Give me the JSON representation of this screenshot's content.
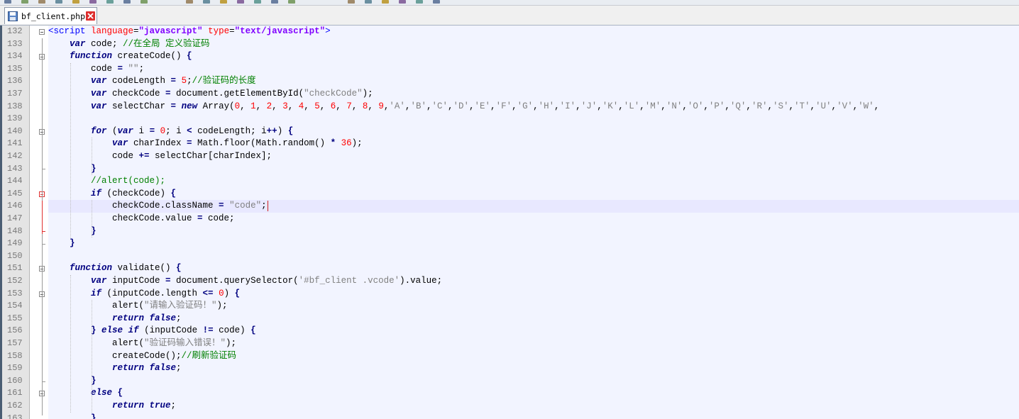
{
  "tab": {
    "filename": "bf_client.php",
    "close_glyph": "✕"
  },
  "colors": {
    "keyword": "#000080",
    "string": "#808080",
    "number": "#ff0000",
    "comment": "#008000",
    "tag": "#0000ff",
    "current_line": "#e8e8ff",
    "fold_active": "#e03030"
  },
  "editor": {
    "current_line_number": "146",
    "lines": [
      {
        "n": "132",
        "indent": 0,
        "tokens": [
          [
            "tag",
            "<script "
          ],
          [
            "attr",
            "language"
          ],
          [
            "plain",
            "="
          ],
          [
            "attrval",
            "\"javascript\""
          ],
          [
            "plain",
            " "
          ],
          [
            "attr",
            "type"
          ],
          [
            "plain",
            "="
          ],
          [
            "attrval",
            "\"text/javascript\""
          ],
          [
            "tag",
            ">"
          ]
        ]
      },
      {
        "n": "133",
        "indent": 1,
        "tokens": [
          [
            "kwi",
            "var"
          ],
          [
            "plain",
            " code; "
          ],
          [
            "com",
            "//在全局 定义验证码"
          ]
        ]
      },
      {
        "n": "134",
        "indent": 1,
        "tokens": [
          [
            "kwi",
            "function"
          ],
          [
            "plain",
            " createCode() "
          ],
          [
            "op",
            "{"
          ]
        ]
      },
      {
        "n": "135",
        "indent": 2,
        "tokens": [
          [
            "plain",
            "code "
          ],
          [
            "op",
            "="
          ],
          [
            "plain",
            " "
          ],
          [
            "str",
            "\"\""
          ],
          [
            "plain",
            ";"
          ]
        ]
      },
      {
        "n": "136",
        "indent": 2,
        "tokens": [
          [
            "kwi",
            "var"
          ],
          [
            "plain",
            " codeLength "
          ],
          [
            "op",
            "="
          ],
          [
            "plain",
            " "
          ],
          [
            "num",
            "5"
          ],
          [
            "plain",
            ";"
          ],
          [
            "com",
            "//验证码的长度"
          ]
        ]
      },
      {
        "n": "137",
        "indent": 2,
        "tokens": [
          [
            "kwi",
            "var"
          ],
          [
            "plain",
            " checkCode "
          ],
          [
            "op",
            "="
          ],
          [
            "plain",
            " document.getElementById("
          ],
          [
            "str",
            "\"checkCode\""
          ],
          [
            "plain",
            ");"
          ]
        ]
      },
      {
        "n": "138",
        "indent": 2,
        "tokens": [
          [
            "kwi",
            "var"
          ],
          [
            "plain",
            " selectChar "
          ],
          [
            "op",
            "="
          ],
          [
            "plain",
            " "
          ],
          [
            "kwi",
            "new"
          ],
          [
            "plain",
            " Array("
          ],
          [
            "num",
            "0"
          ],
          [
            "plain",
            ", "
          ],
          [
            "num",
            "1"
          ],
          [
            "plain",
            ", "
          ],
          [
            "num",
            "2"
          ],
          [
            "plain",
            ", "
          ],
          [
            "num",
            "3"
          ],
          [
            "plain",
            ", "
          ],
          [
            "num",
            "4"
          ],
          [
            "plain",
            ", "
          ],
          [
            "num",
            "5"
          ],
          [
            "plain",
            ", "
          ],
          [
            "num",
            "6"
          ],
          [
            "plain",
            ", "
          ],
          [
            "num",
            "7"
          ],
          [
            "plain",
            ", "
          ],
          [
            "num",
            "8"
          ],
          [
            "plain",
            ", "
          ],
          [
            "num",
            "9"
          ],
          [
            "plain",
            ","
          ],
          [
            "str",
            "'A'"
          ],
          [
            "plain",
            ","
          ],
          [
            "str",
            "'B'"
          ],
          [
            "plain",
            ","
          ],
          [
            "str",
            "'C'"
          ],
          [
            "plain",
            ","
          ],
          [
            "str",
            "'D'"
          ],
          [
            "plain",
            ","
          ],
          [
            "str",
            "'E'"
          ],
          [
            "plain",
            ","
          ],
          [
            "str",
            "'F'"
          ],
          [
            "plain",
            ","
          ],
          [
            "str",
            "'G'"
          ],
          [
            "plain",
            ","
          ],
          [
            "str",
            "'H'"
          ],
          [
            "plain",
            ","
          ],
          [
            "str",
            "'I'"
          ],
          [
            "plain",
            ","
          ],
          [
            "str",
            "'J'"
          ],
          [
            "plain",
            ","
          ],
          [
            "str",
            "'K'"
          ],
          [
            "plain",
            ","
          ],
          [
            "str",
            "'L'"
          ],
          [
            "plain",
            ","
          ],
          [
            "str",
            "'M'"
          ],
          [
            "plain",
            ","
          ],
          [
            "str",
            "'N'"
          ],
          [
            "plain",
            ","
          ],
          [
            "str",
            "'O'"
          ],
          [
            "plain",
            ","
          ],
          [
            "str",
            "'P'"
          ],
          [
            "plain",
            ","
          ],
          [
            "str",
            "'Q'"
          ],
          [
            "plain",
            ","
          ],
          [
            "str",
            "'R'"
          ],
          [
            "plain",
            ","
          ],
          [
            "str",
            "'S'"
          ],
          [
            "plain",
            ","
          ],
          [
            "str",
            "'T'"
          ],
          [
            "plain",
            ","
          ],
          [
            "str",
            "'U'"
          ],
          [
            "plain",
            ","
          ],
          [
            "str",
            "'V'"
          ],
          [
            "plain",
            ","
          ],
          [
            "str",
            "'W'"
          ],
          [
            "plain",
            ","
          ]
        ]
      },
      {
        "n": "139",
        "indent": 0,
        "tokens": []
      },
      {
        "n": "140",
        "indent": 2,
        "tokens": [
          [
            "kwi",
            "for"
          ],
          [
            "plain",
            " ("
          ],
          [
            "kwi",
            "var"
          ],
          [
            "plain",
            " i "
          ],
          [
            "op",
            "="
          ],
          [
            "plain",
            " "
          ],
          [
            "num",
            "0"
          ],
          [
            "plain",
            "; i "
          ],
          [
            "op",
            "<"
          ],
          [
            "plain",
            " codeLength; i"
          ],
          [
            "op",
            "++"
          ],
          [
            "plain",
            ") "
          ],
          [
            "op",
            "{"
          ]
        ]
      },
      {
        "n": "141",
        "indent": 3,
        "tokens": [
          [
            "kwi",
            "var"
          ],
          [
            "plain",
            " charIndex "
          ],
          [
            "op",
            "="
          ],
          [
            "plain",
            " Math.floor(Math.random() "
          ],
          [
            "op",
            "*"
          ],
          [
            "plain",
            " "
          ],
          [
            "num",
            "36"
          ],
          [
            "plain",
            ");"
          ]
        ]
      },
      {
        "n": "142",
        "indent": 3,
        "tokens": [
          [
            "plain",
            "code "
          ],
          [
            "op",
            "+="
          ],
          [
            "plain",
            " selectChar[charIndex];"
          ]
        ]
      },
      {
        "n": "143",
        "indent": 2,
        "tokens": [
          [
            "op",
            "}"
          ]
        ]
      },
      {
        "n": "144",
        "indent": 2,
        "tokens": [
          [
            "com",
            "//alert(code);"
          ]
        ]
      },
      {
        "n": "145",
        "indent": 2,
        "tokens": [
          [
            "kwi",
            "if"
          ],
          [
            "plain",
            " (checkCode) "
          ],
          [
            "op",
            "{"
          ]
        ]
      },
      {
        "n": "146",
        "indent": 3,
        "tokens": [
          [
            "plain",
            "checkCode.className "
          ],
          [
            "op",
            "="
          ],
          [
            "plain",
            " "
          ],
          [
            "str",
            "\"code\""
          ],
          [
            "plain",
            ";"
          ]
        ]
      },
      {
        "n": "147",
        "indent": 3,
        "tokens": [
          [
            "plain",
            "checkCode.value "
          ],
          [
            "op",
            "="
          ],
          [
            "plain",
            " code;"
          ]
        ]
      },
      {
        "n": "148",
        "indent": 2,
        "tokens": [
          [
            "op",
            "}"
          ]
        ]
      },
      {
        "n": "149",
        "indent": 1,
        "tokens": [
          [
            "op",
            "}"
          ]
        ]
      },
      {
        "n": "150",
        "indent": 0,
        "tokens": []
      },
      {
        "n": "151",
        "indent": 1,
        "tokens": [
          [
            "kwi",
            "function"
          ],
          [
            "plain",
            " validate() "
          ],
          [
            "op",
            "{"
          ]
        ]
      },
      {
        "n": "152",
        "indent": 2,
        "tokens": [
          [
            "kwi",
            "var"
          ],
          [
            "plain",
            " inputCode "
          ],
          [
            "op",
            "="
          ],
          [
            "plain",
            " document.querySelector("
          ],
          [
            "str",
            "'#bf_client .vcode'"
          ],
          [
            "plain",
            ").value;"
          ]
        ]
      },
      {
        "n": "153",
        "indent": 2,
        "tokens": [
          [
            "kwi",
            "if"
          ],
          [
            "plain",
            " (inputCode.length "
          ],
          [
            "op",
            "<="
          ],
          [
            "plain",
            " "
          ],
          [
            "num",
            "0"
          ],
          [
            "plain",
            ") "
          ],
          [
            "op",
            "{"
          ]
        ]
      },
      {
        "n": "154",
        "indent": 3,
        "tokens": [
          [
            "plain",
            "alert("
          ],
          [
            "str",
            "\"请输入验证码！\""
          ],
          [
            "plain",
            ");"
          ]
        ]
      },
      {
        "n": "155",
        "indent": 3,
        "tokens": [
          [
            "kwi",
            "return"
          ],
          [
            "plain",
            " "
          ],
          [
            "kwi",
            "false"
          ],
          [
            "plain",
            ";"
          ]
        ]
      },
      {
        "n": "156",
        "indent": 2,
        "tokens": [
          [
            "op",
            "}"
          ],
          [
            "plain",
            " "
          ],
          [
            "kwi",
            "else"
          ],
          [
            "plain",
            " "
          ],
          [
            "kwi",
            "if"
          ],
          [
            "plain",
            " (inputCode "
          ],
          [
            "op",
            "!="
          ],
          [
            "plain",
            " code) "
          ],
          [
            "op",
            "{"
          ]
        ]
      },
      {
        "n": "157",
        "indent": 3,
        "tokens": [
          [
            "plain",
            "alert("
          ],
          [
            "str",
            "\"验证码输入错误！\""
          ],
          [
            "plain",
            ");"
          ]
        ]
      },
      {
        "n": "158",
        "indent": 3,
        "tokens": [
          [
            "plain",
            "createCode();"
          ],
          [
            "com",
            "//刷新验证码"
          ]
        ]
      },
      {
        "n": "159",
        "indent": 3,
        "tokens": [
          [
            "kwi",
            "return"
          ],
          [
            "plain",
            " "
          ],
          [
            "kwi",
            "false"
          ],
          [
            "plain",
            ";"
          ]
        ]
      },
      {
        "n": "160",
        "indent": 2,
        "tokens": [
          [
            "op",
            "}"
          ]
        ]
      },
      {
        "n": "161",
        "indent": 2,
        "tokens": [
          [
            "kwi",
            "else"
          ],
          [
            "plain",
            " "
          ],
          [
            "op",
            "{"
          ]
        ]
      },
      {
        "n": "162",
        "indent": 3,
        "tokens": [
          [
            "kwi",
            "return"
          ],
          [
            "plain",
            " "
          ],
          [
            "kwi",
            "true"
          ],
          [
            "plain",
            ";"
          ]
        ]
      },
      {
        "n": "163",
        "indent": 2,
        "tokens": [
          [
            "op",
            "}"
          ]
        ]
      }
    ]
  }
}
